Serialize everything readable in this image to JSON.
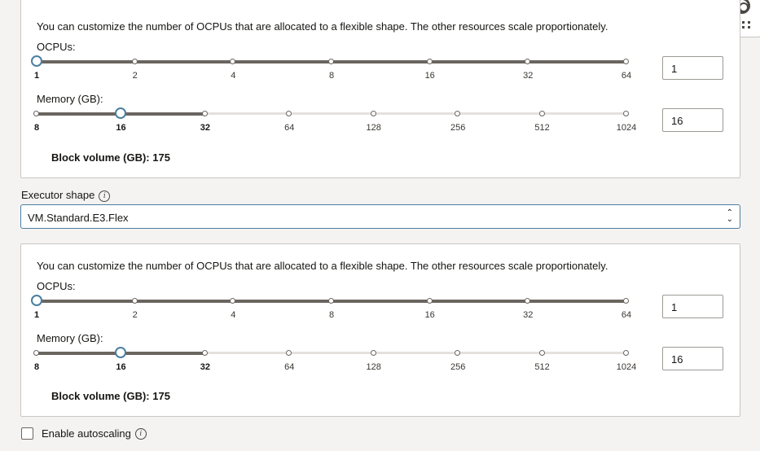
{
  "description": "You can customize the number of OCPUs that are allocated to a flexible shape. The other resources scale proportionately.",
  "ocpu_label": "OCPUs:",
  "memory_label": "Memory (GB):",
  "ocpu_ticks": [
    "1",
    "2",
    "4",
    "8",
    "16",
    "32",
    "64"
  ],
  "memory_ticks": [
    "8",
    "16",
    "32",
    "64",
    "128",
    "256",
    "512",
    "1024"
  ],
  "driver": {
    "ocpu_value": "1",
    "memory_value": "16",
    "block_volume": "Block volume (GB): 175"
  },
  "executor_shape": {
    "label": "Executor shape",
    "value": "VM.Standard.E3.Flex",
    "info_icon": "info-icon"
  },
  "executor": {
    "ocpu_value": "1",
    "memory_value": "16",
    "block_volume": "Block volume (GB): 175"
  },
  "autoscaling": {
    "label": "Enable autoscaling",
    "checked": false
  },
  "colors": {
    "accent": "#4b7fa0",
    "slider_fill": "#6b6560",
    "panel_border": "#c9c6c2"
  },
  "icons": {
    "help": "lifebuoy-icon",
    "apps": "grid-icon"
  }
}
